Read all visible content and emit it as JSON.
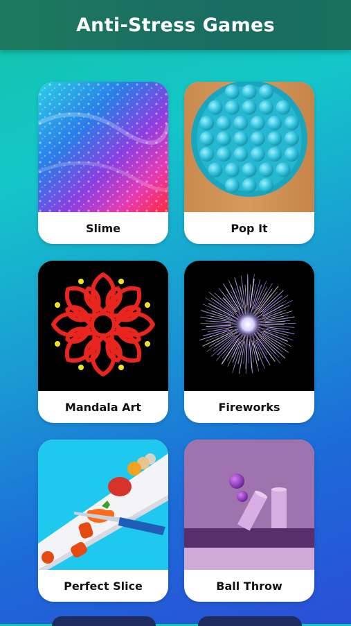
{
  "header": {
    "title": "Anti-Stress Games"
  },
  "games": [
    {
      "label": "Slime",
      "icon": "slime-thumbnail"
    },
    {
      "label": "Pop It",
      "icon": "pop-it-thumbnail"
    },
    {
      "label": "Mandala Art",
      "icon": "mandala-thumbnail"
    },
    {
      "label": "Fireworks",
      "icon": "fireworks-thumbnail"
    },
    {
      "label": "Perfect Slice",
      "icon": "perfect-slice-thumbnail"
    },
    {
      "label": "Ball Throw",
      "icon": "ball-throw-thumbnail"
    }
  ],
  "colors": {
    "header": "#1d7a5e",
    "card": "#ffffff",
    "mandala": "#e8261f",
    "popit": "#29b9d3"
  }
}
